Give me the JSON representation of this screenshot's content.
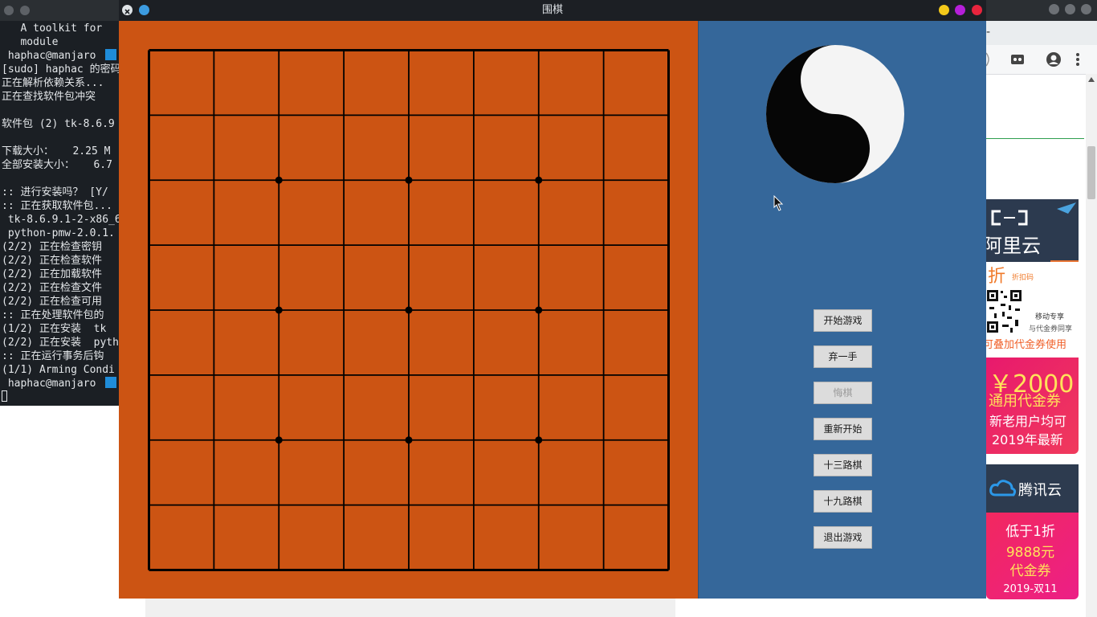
{
  "app_window": {
    "title": "围棋",
    "colors": {
      "board": "#cc5413",
      "panel": "#35679a",
      "grid": "#000000"
    },
    "board": {
      "grid_lines": 9,
      "star_points": [
        [
          2,
          2
        ],
        [
          2,
          4
        ],
        [
          2,
          6
        ],
        [
          4,
          2
        ],
        [
          4,
          4
        ],
        [
          4,
          6
        ],
        [
          6,
          2
        ],
        [
          6,
          4
        ],
        [
          6,
          6
        ]
      ]
    },
    "titlebar_icons": [
      "close-app-icon",
      "sticky-icon"
    ],
    "window_controls": [
      "minimize-icon",
      "maximize-icon",
      "close-icon"
    ],
    "buttons": [
      {
        "label": "开始游戏",
        "enabled": true
      },
      {
        "label": "弃一手",
        "enabled": true
      },
      {
        "label": "悔棋",
        "enabled": false
      },
      {
        "label": "重新开始",
        "enabled": true
      },
      {
        "label": "十三路棋",
        "enabled": true
      },
      {
        "label": "十九路棋",
        "enabled": true
      },
      {
        "label": "退出游戏",
        "enabled": true
      }
    ]
  },
  "terminal": {
    "lines": [
      "   A toolkit for ",
      "   module",
      " haphac@manjaro ",
      "[sudo] haphac 的密码",
      "正在解析依赖关系...",
      "正在查找软件包冲突",
      "",
      "软件包 (2) tk-8.6.9",
      "",
      "下载大小：   2.25 M",
      "全部安装大小：   6.7",
      "",
      ":: 进行安装吗？ [Y/",
      ":: 正在获取软件包...",
      " tk-8.6.9.1-2-x86_6",
      " python-pmw-2.0.1.",
      "(2/2) 正在检查密钥",
      "(2/2) 正在检查软件",
      "(2/2) 正在加载软件",
      "(2/2) 正在检查文件",
      "(2/2) 正在检查可用",
      ":: 正在处理软件包的",
      "(1/2) 正在安装  tk",
      "(2/2) 正在安装  pyth",
      ":: 正在运行事务后钩",
      "(1/1) Arming Condi",
      " haphac@manjaro "
    ]
  },
  "browser_ads": {
    "aliyun_logo": "阿里云",
    "discount_big": "折",
    "discount_small": "折扣码",
    "mobile_exclusive": "移动专享",
    "with_coupon": "与代金券同享",
    "stackable": "可叠加代金券使用",
    "amount": "￥2000",
    "general_coupon": "通用代金券",
    "new_old_users": "新老用户均可",
    "year_latest": "2019年最新",
    "tencent_logo": "腾讯云",
    "below_discount": "低于1折",
    "amount_2": "9888元",
    "coupon": "代金券",
    "date": "2019-双11"
  }
}
